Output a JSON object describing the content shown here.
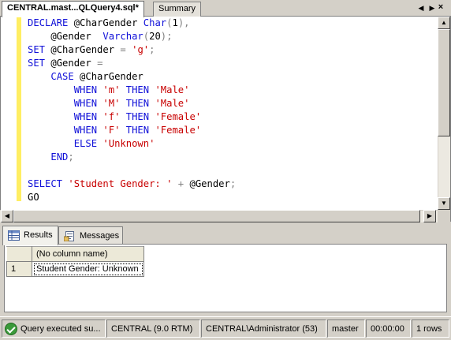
{
  "doc_tabs": [
    {
      "label": "CENTRAL.mast...QLQuery4.sql*"
    },
    {
      "label": "Summary"
    }
  ],
  "tab_controls": {
    "left_icon": "triangle-left-icon",
    "right_icon": "triangle-right-icon",
    "close_glyph": "×"
  },
  "code": [
    [
      {
        "t": "kw",
        "s": "DECLARE "
      },
      {
        "t": "txt",
        "s": "@CharGender "
      },
      {
        "t": "kw",
        "s": "Char"
      },
      {
        "t": "op",
        "s": "("
      },
      {
        "t": "txt",
        "s": "1"
      },
      {
        "t": "op",
        "s": "),"
      }
    ],
    [
      {
        "t": "txt",
        "s": "    @Gender  "
      },
      {
        "t": "kw",
        "s": "Varchar"
      },
      {
        "t": "op",
        "s": "("
      },
      {
        "t": "txt",
        "s": "20"
      },
      {
        "t": "op",
        "s": ");"
      }
    ],
    [
      {
        "t": "kw",
        "s": "SET "
      },
      {
        "t": "txt",
        "s": "@CharGender "
      },
      {
        "t": "op",
        "s": "= "
      },
      {
        "t": "str",
        "s": "'g'"
      },
      {
        "t": "op",
        "s": ";"
      }
    ],
    [
      {
        "t": "kw",
        "s": "SET "
      },
      {
        "t": "txt",
        "s": "@Gender "
      },
      {
        "t": "op",
        "s": "="
      }
    ],
    [
      {
        "t": "txt",
        "s": "    "
      },
      {
        "t": "kw",
        "s": "CASE "
      },
      {
        "t": "txt",
        "s": "@CharGender"
      }
    ],
    [
      {
        "t": "txt",
        "s": "        "
      },
      {
        "t": "kw",
        "s": "WHEN "
      },
      {
        "t": "str",
        "s": "'m' "
      },
      {
        "t": "kw",
        "s": "THEN "
      },
      {
        "t": "str",
        "s": "'Male'"
      }
    ],
    [
      {
        "t": "txt",
        "s": "        "
      },
      {
        "t": "kw",
        "s": "WHEN "
      },
      {
        "t": "str",
        "s": "'M' "
      },
      {
        "t": "kw",
        "s": "THEN "
      },
      {
        "t": "str",
        "s": "'Male'"
      }
    ],
    [
      {
        "t": "txt",
        "s": "        "
      },
      {
        "t": "kw",
        "s": "WHEN "
      },
      {
        "t": "str",
        "s": "'f' "
      },
      {
        "t": "kw",
        "s": "THEN "
      },
      {
        "t": "str",
        "s": "'Female'"
      }
    ],
    [
      {
        "t": "txt",
        "s": "        "
      },
      {
        "t": "kw",
        "s": "WHEN "
      },
      {
        "t": "str",
        "s": "'F' "
      },
      {
        "t": "kw",
        "s": "THEN "
      },
      {
        "t": "str",
        "s": "'Female'"
      }
    ],
    [
      {
        "t": "txt",
        "s": "        "
      },
      {
        "t": "kw",
        "s": "ELSE "
      },
      {
        "t": "str",
        "s": "'Unknown'"
      }
    ],
    [
      {
        "t": "txt",
        "s": "    "
      },
      {
        "t": "kw",
        "s": "END"
      },
      {
        "t": "op",
        "s": ";"
      }
    ],
    [],
    [
      {
        "t": "kw",
        "s": "SELECT "
      },
      {
        "t": "str",
        "s": "'Student Gender: ' "
      },
      {
        "t": "op",
        "s": "+ "
      },
      {
        "t": "txt",
        "s": "@Gender"
      },
      {
        "t": "op",
        "s": ";"
      }
    ],
    [
      {
        "t": "txt",
        "s": "GO"
      }
    ]
  ],
  "result_tabs": [
    {
      "label": "Results",
      "icon": "grid-icon"
    },
    {
      "label": "Messages",
      "icon": "messages-icon"
    }
  ],
  "grid": {
    "column_header": "(No column name)",
    "rows": [
      {
        "row_number": "1",
        "value": "Student Gender: Unknown"
      }
    ]
  },
  "status": {
    "message": "Query executed su...",
    "server": "CENTRAL (9.0 RTM)",
    "user": "CENTRAL\\Administrator (53)",
    "database": "master",
    "elapsed": "00:00:00",
    "rows": "1 rows"
  },
  "colors": {
    "keyword": "#1010d8",
    "string": "#c80000",
    "operator": "#808080",
    "change_bar": "#ffee62"
  }
}
